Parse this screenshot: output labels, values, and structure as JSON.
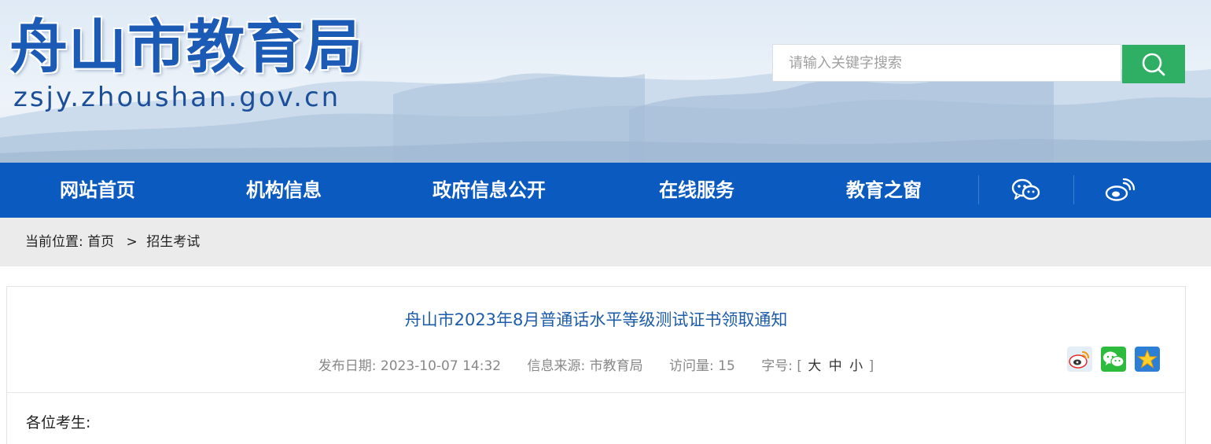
{
  "header": {
    "site_title": "舟山市教育局",
    "site_domain": "zsjy.zhoushan.gov.cn",
    "search": {
      "placeholder": "请输入关键字搜索"
    }
  },
  "nav": {
    "items": [
      {
        "label": "网站首页"
      },
      {
        "label": "机构信息"
      },
      {
        "label": "政府信息公开"
      },
      {
        "label": "在线服务"
      },
      {
        "label": "教育之窗"
      }
    ],
    "icons": [
      "wechat-icon",
      "weibo-icon"
    ]
  },
  "breadcrumb": {
    "prefix": "当前位置:",
    "home": "首页",
    "separator": ">",
    "current": "招生考试"
  },
  "article": {
    "title": "舟山市2023年8月普通话水平等级测试证书领取通知",
    "publish": "发布日期: 2023-10-07 14:32",
    "source": "信息来源: 市教育局",
    "views": "访问量: 15",
    "font_size_label": "字号:",
    "font_size_large": "大",
    "font_size_medium": "中",
    "font_size_small": "小",
    "bracket_open": "[",
    "bracket_close": "]",
    "share_icons": [
      "weibo-share-icon",
      "wechat-share-icon",
      "favorite-icon"
    ],
    "body_first_line": "各位考生:"
  },
  "colors": {
    "nav_bg": "#0b5ac0",
    "search_button": "#2eaf63",
    "title_blue": "#1d5caa",
    "breadcrumb_bg": "#ebebeb"
  }
}
